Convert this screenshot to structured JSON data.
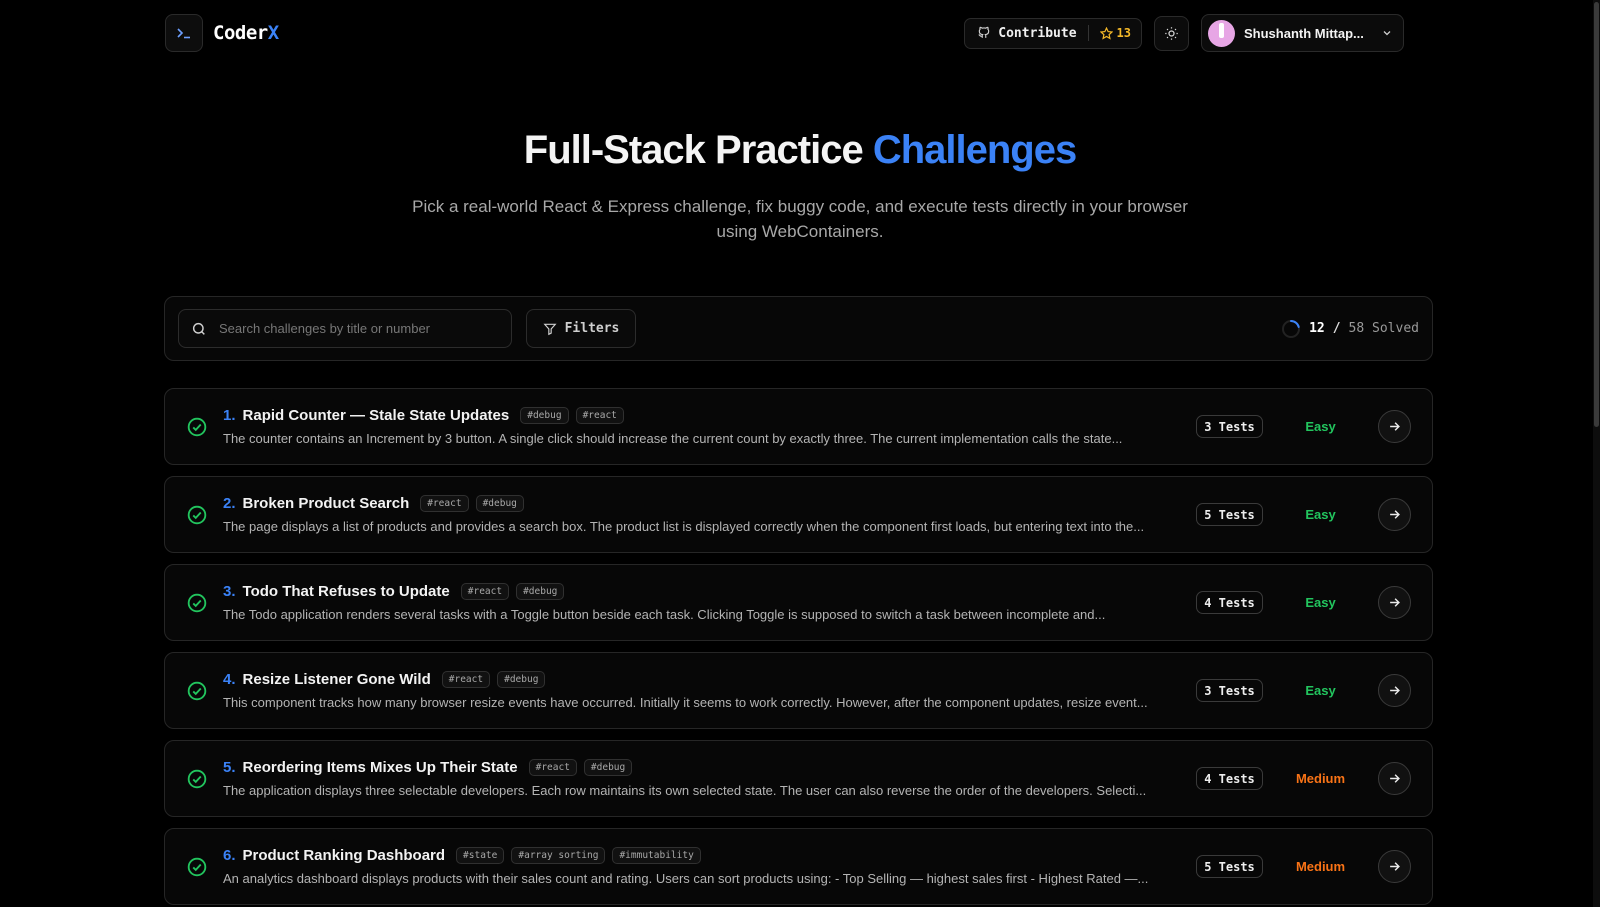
{
  "app": {
    "name_main": "Coder",
    "name_accent": "X",
    "logo_glyph": ">_"
  },
  "header": {
    "contribute_label": "Contribute",
    "star_count": "13",
    "user_name": "Shushanth Mittap..."
  },
  "hero": {
    "title_main": "Full-Stack Practice ",
    "title_accent": "Challenges",
    "subtitle": "Pick a real-world React & Express challenge, fix buggy code, and execute tests directly in your browser using WebContainers."
  },
  "toolbar": {
    "search_placeholder": "Search challenges by title or number",
    "filters_label": "Filters",
    "solved_count": "12",
    "solved_sep": "/",
    "solved_total": "58 Solved",
    "solved_fraction": 0.207
  },
  "colors": {
    "accent": "#3b82f6",
    "easy": "#22c55e",
    "medium": "#f97316",
    "solved_check": "#22c55e"
  },
  "challenges": [
    {
      "num": "1.",
      "title": "Rapid Counter — Stale State Updates",
      "tags": [
        "#debug",
        "#react"
      ],
      "desc": "The counter contains an Increment by 3 button. A single click should increase the current count by exactly three. The current implementation calls the state...",
      "tests": "3 Tests",
      "difficulty": "Easy"
    },
    {
      "num": "2.",
      "title": "Broken Product Search",
      "tags": [
        "#react",
        "#debug"
      ],
      "desc": "The page displays a list of products and provides a search box. The product list is displayed correctly when the component first loads, but entering text into the...",
      "tests": "5 Tests",
      "difficulty": "Easy"
    },
    {
      "num": "3.",
      "title": "Todo That Refuses to Update",
      "tags": [
        "#react",
        "#debug"
      ],
      "desc": "The Todo application renders several tasks with a Toggle button beside each task. Clicking Toggle is supposed to switch a task between incomplete and...",
      "tests": "4 Tests",
      "difficulty": "Easy"
    },
    {
      "num": "4.",
      "title": "Resize Listener Gone Wild",
      "tags": [
        "#react",
        "#debug"
      ],
      "desc": "This component tracks how many browser resize events have occurred. Initially it seems to work correctly. However, after the component updates, resize event...",
      "tests": "3 Tests",
      "difficulty": "Easy"
    },
    {
      "num": "5.",
      "title": "Reordering Items Mixes Up Their State",
      "tags": [
        "#react",
        "#debug"
      ],
      "desc": "The application displays three selectable developers. Each row maintains its own selected state. The user can also reverse the order of the developers. Selecti...",
      "tests": "4 Tests",
      "difficulty": "Medium"
    },
    {
      "num": "6.",
      "title": "Product Ranking Dashboard",
      "tags": [
        "#state",
        "#array sorting",
        "#immutability"
      ],
      "desc": "An analytics dashboard displays products with their sales count and rating. Users can sort products using: - Top Selling — highest sales first - Highest Rated —...",
      "tests": "5 Tests",
      "difficulty": "Medium"
    }
  ]
}
